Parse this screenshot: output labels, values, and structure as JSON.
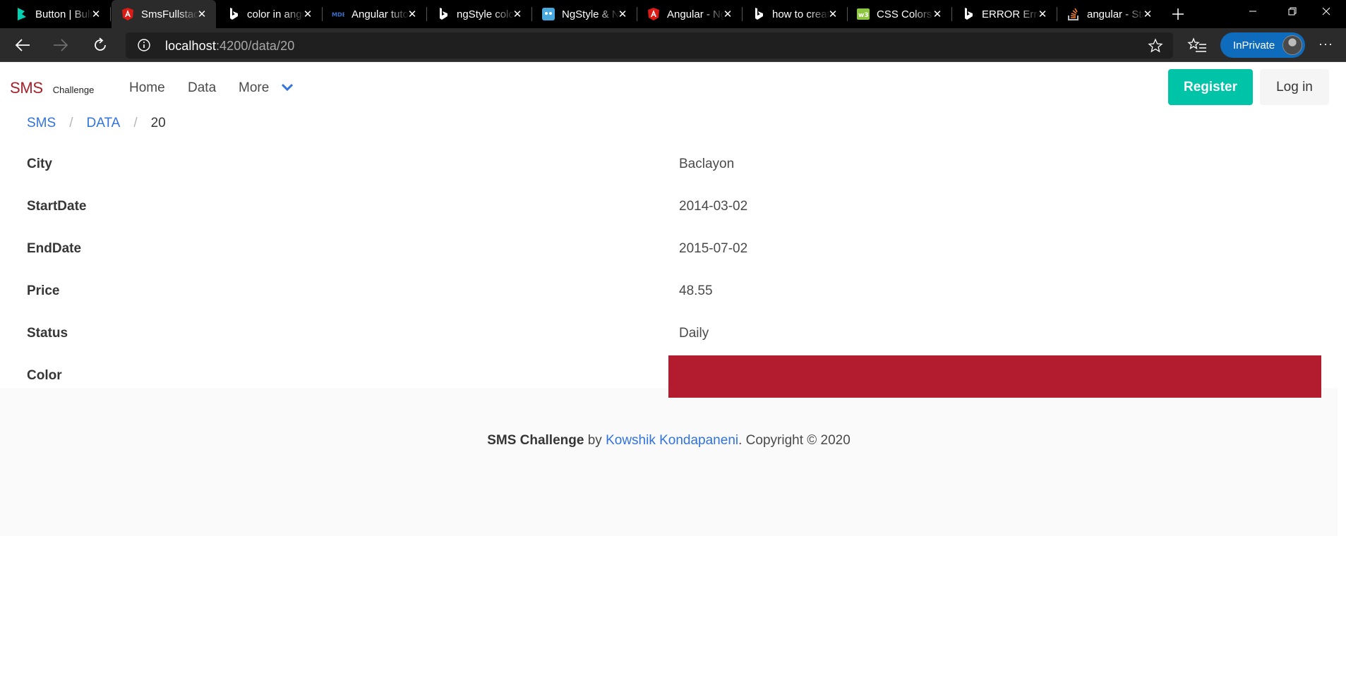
{
  "browser": {
    "tabs": [
      {
        "title": "Button | Bulma",
        "favicon": "bulma-icon",
        "active": false
      },
      {
        "title": "SmsFullstack",
        "favicon": "angular-icon",
        "active": true
      },
      {
        "title": "color in angular",
        "favicon": "bing-icon",
        "active": false
      },
      {
        "title": "Angular tutorial",
        "favicon": "mdb-icon",
        "active": false
      },
      {
        "title": "ngStyle color",
        "favicon": "bing-icon",
        "active": false
      },
      {
        "title": "NgStyle & NgClass",
        "favicon": "ngstyle-icon",
        "active": false
      },
      {
        "title": "Angular - NgStyle",
        "favicon": "angular-icon",
        "active": false
      },
      {
        "title": "how to create",
        "favicon": "bing-icon",
        "active": false
      },
      {
        "title": "CSS Colors",
        "favicon": "w3schools-icon",
        "active": false
      },
      {
        "title": "ERROR Error",
        "favicon": "bing-icon",
        "active": false
      },
      {
        "title": "angular - Stack Overflow",
        "favicon": "stackoverflow-icon",
        "active": false
      }
    ],
    "url_host": "localhost",
    "url_path": ":4200/data/20",
    "inprivate_label": "InPrivate"
  },
  "nav": {
    "brand_primary": "SMS",
    "brand_secondary": "Challenge",
    "links": [
      "Home",
      "Data",
      "More"
    ],
    "register_label": "Register",
    "login_label": "Log in"
  },
  "breadcrumb": {
    "items": [
      "SMS",
      "DATA"
    ],
    "current": "20",
    "separator": "/"
  },
  "details": [
    {
      "label": "City",
      "value": "Baclayon"
    },
    {
      "label": "StartDate",
      "value": "2014-03-02"
    },
    {
      "label": "EndDate",
      "value": "2015-07-02"
    },
    {
      "label": "Price",
      "value": "48.55"
    },
    {
      "label": "Status",
      "value": "Daily"
    },
    {
      "label": "Color",
      "value": ""
    }
  ],
  "color_swatch": "#b31b2e",
  "footer": {
    "title": "SMS Challenge",
    "by": "by",
    "author": "Kowshik Kondapaneni",
    "copyright": ". Copyright © 2020"
  },
  "colors": {
    "accent_link": "#3273dc",
    "register_button": "#00c4a7",
    "brand_red": "#a5212a"
  }
}
